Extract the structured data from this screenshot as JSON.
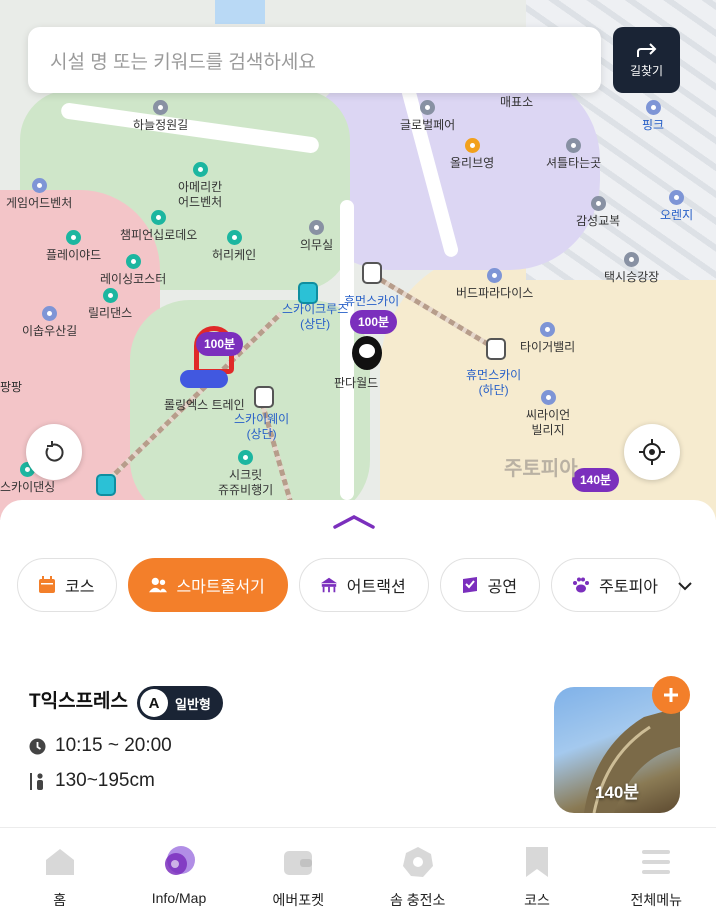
{
  "search": {
    "placeholder": "시설 명 또는 키워드를 검색하세요",
    "directions_label": "길찾기"
  },
  "map": {
    "pois": [
      {
        "label": "하늘정원길",
        "icon": "parking-icon"
      },
      {
        "label": "글로벌페어",
        "icon": "parking-icon"
      },
      {
        "label": "매표소",
        "icon": "ticket-office-icon"
      },
      {
        "label": "핑크",
        "icon": "parking-icon"
      },
      {
        "label": "올리브영",
        "icon": "shop-icon"
      },
      {
        "label": "셔틀타는곳",
        "icon": "shuttle-icon"
      },
      {
        "label": "게임어드벤처",
        "icon": "attraction-icon"
      },
      {
        "label": "아메리칸\n어드벤처",
        "icon": "attraction-icon"
      },
      {
        "label": "오렌지",
        "icon": "parking-icon"
      },
      {
        "label": "감성교복",
        "icon": "shop-icon"
      },
      {
        "label": "챔피언십로데오",
        "icon": "attraction-icon"
      },
      {
        "label": "의무실",
        "icon": "first-aid-icon"
      },
      {
        "label": "플레이야드",
        "icon": "attraction-icon"
      },
      {
        "label": "허리케인",
        "icon": "attraction-icon"
      },
      {
        "label": "택시승강장",
        "icon": "taxi-icon"
      },
      {
        "label": "레이싱코스터",
        "icon": "attraction-icon"
      },
      {
        "label": "버드파라다이스",
        "icon": "attraction-icon"
      },
      {
        "label": "휴먼스카이",
        "icon": "gondola-icon"
      },
      {
        "label": "스카이크루즈\n(상단)",
        "icon": "gondola-icon"
      },
      {
        "label": "릴리댄스",
        "icon": "attraction-icon"
      },
      {
        "label": "이솝우산길",
        "icon": "attraction-icon"
      },
      {
        "label": "타이거밸리",
        "icon": "attraction-icon"
      },
      {
        "label": "휴먼스카이\n(하단)",
        "icon": "gondola-icon"
      },
      {
        "label": "판다월드",
        "icon": "attraction-icon"
      },
      {
        "label": "팡팡",
        "icon": "attraction-icon"
      },
      {
        "label": "롤링엑스 트레인",
        "icon": "attraction-icon"
      },
      {
        "label": "스카이웨이\n(상단)",
        "icon": "gondola-icon"
      },
      {
        "label": "씨라이언\n빌리지",
        "icon": "attraction-icon"
      },
      {
        "label": "시크릿\n쥬쥬비행기",
        "icon": "attraction-icon"
      },
      {
        "label": "스카이댄싱",
        "icon": "attraction-icon"
      }
    ],
    "wait_bubbles": [
      "100분",
      "100분",
      "140분"
    ],
    "area_label": "주토피아"
  },
  "chips": [
    {
      "label": "코스",
      "icon": "calendar-icon"
    },
    {
      "label": "스마트줄서기",
      "icon": "people-icon",
      "active": true
    },
    {
      "label": "어트랙션",
      "icon": "ride-icon"
    },
    {
      "label": "공연",
      "icon": "performance-icon"
    },
    {
      "label": "주토피아",
      "icon": "paw-icon"
    }
  ],
  "attraction": {
    "name": "T익스프레스",
    "badge_letter": "A",
    "badge_label": "일반형",
    "hours": "10:15 ~ 20:00",
    "height": "130~195cm",
    "wait": "140분"
  },
  "tabs": [
    {
      "label": "홈",
      "icon": "home-icon"
    },
    {
      "label": "Info/Map",
      "icon": "map-icon"
    },
    {
      "label": "에버포켓",
      "icon": "wallet-icon"
    },
    {
      "label": "솜 충전소",
      "icon": "charge-icon"
    },
    {
      "label": "코스",
      "icon": "bookmark-icon"
    },
    {
      "label": "전체메뉴",
      "icon": "menu-icon"
    }
  ],
  "colors": {
    "accent_orange": "#f37f2a",
    "purple": "#7b2fbd",
    "navy": "#1a2435",
    "teal": "#1cb6a0"
  }
}
